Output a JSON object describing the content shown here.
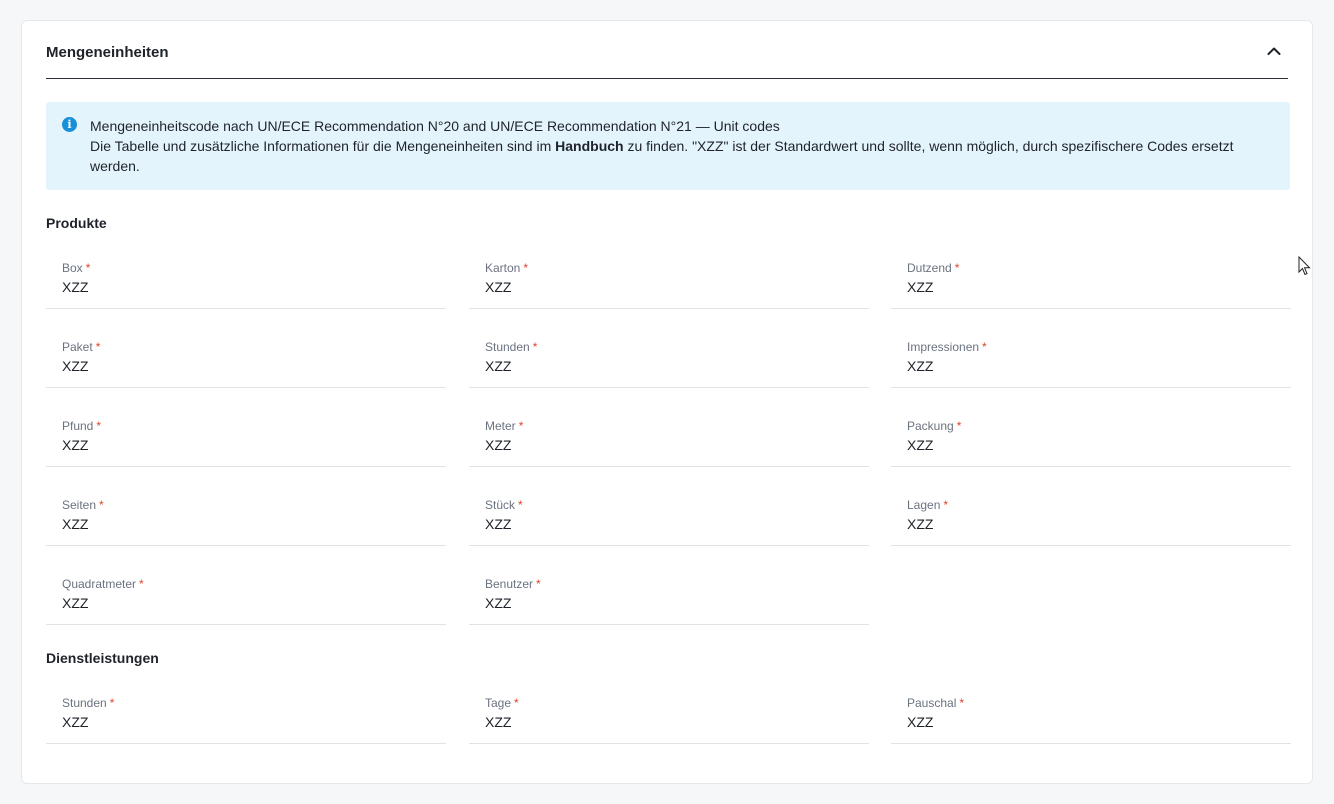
{
  "panel": {
    "title": "Mengeneinheiten"
  },
  "info": {
    "line1": "Mengeneinheitscode nach UN/ECE Recommendation N°20 and UN/ECE Recommendation N°21 — Unit codes",
    "line2_before": "Die Tabelle und zusätzliche Informationen für die Mengeneinheiten sind im ",
    "line2_bold": "Handbuch",
    "line2_after": " zu finden. \"XZZ\" ist der Standardwert und sollte, wenn möglich, durch spezifischere Codes ersetzt werden."
  },
  "produkte": {
    "title": "Produkte",
    "fields": [
      {
        "label": "Box",
        "value": "XZZ"
      },
      {
        "label": "Karton",
        "value": "XZZ"
      },
      {
        "label": "Dutzend",
        "value": "XZZ"
      },
      {
        "label": "Paket",
        "value": "XZZ"
      },
      {
        "label": "Stunden",
        "value": "XZZ"
      },
      {
        "label": "Impressionen",
        "value": "XZZ"
      },
      {
        "label": "Pfund",
        "value": "XZZ"
      },
      {
        "label": "Meter",
        "value": "XZZ"
      },
      {
        "label": "Packung",
        "value": "XZZ"
      },
      {
        "label": "Seiten",
        "value": "XZZ"
      },
      {
        "label": "Stück",
        "value": "XZZ"
      },
      {
        "label": "Lagen",
        "value": "XZZ"
      },
      {
        "label": "Quadratmeter",
        "value": "XZZ"
      },
      {
        "label": "Benutzer",
        "value": "XZZ"
      }
    ]
  },
  "dienstleistungen": {
    "title": "Dienstleistungen",
    "fields": [
      {
        "label": "Stunden",
        "value": "XZZ"
      },
      {
        "label": "Tage",
        "value": "XZZ"
      },
      {
        "label": "Pauschal",
        "value": "XZZ"
      }
    ]
  },
  "required_marker": "*",
  "colors": {
    "info_background": "#e4f4fd",
    "info_icon": "#1b8fd6",
    "required": "#e0442c"
  }
}
